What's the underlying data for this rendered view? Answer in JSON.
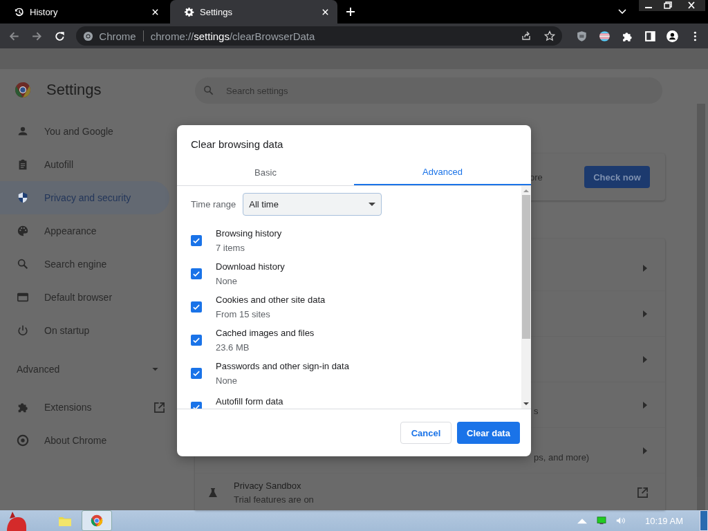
{
  "browser_tabs": [
    {
      "title": "History",
      "selected": false
    },
    {
      "title": "Settings",
      "selected": true
    }
  ],
  "address_bar": {
    "site_label": "Chrome",
    "url_scheme": "chrome://",
    "url_host": "settings",
    "url_path": "/clearBrowserData"
  },
  "settings": {
    "title": "Settings",
    "search": {
      "placeholder": "Search settings"
    },
    "sidebar": {
      "items": [
        {
          "label": "You and Google",
          "selected": false
        },
        {
          "label": "Autofill",
          "selected": false
        },
        {
          "label": "Privacy and security",
          "selected": true
        },
        {
          "label": "Appearance",
          "selected": false
        },
        {
          "label": "Search engine",
          "selected": false
        },
        {
          "label": "Default browser",
          "selected": false
        },
        {
          "label": "On startup",
          "selected": false
        }
      ],
      "advanced": {
        "label": "Advanced",
        "expanded": false
      },
      "links": [
        {
          "label": "Extensions",
          "external": true
        },
        {
          "label": "About Chrome",
          "external": false
        }
      ]
    },
    "safety_check": {
      "text_fragment": "ore",
      "button": "Check now"
    },
    "privacy_rows": [
      {},
      {},
      {},
      {
        "text": "s"
      },
      {
        "text": "ps, and more)"
      }
    ],
    "privacy_sandbox": {
      "title": "Privacy Sandbox",
      "subtitle": "Trial features are on"
    }
  },
  "dialog": {
    "title": "Clear browsing data",
    "tabs": [
      {
        "label": "Basic",
        "selected": false
      },
      {
        "label": "Advanced",
        "selected": true
      }
    ],
    "time_range": {
      "label": "Time range",
      "value": "All time"
    },
    "options": [
      {
        "label": "Browsing history",
        "detail": "7 items",
        "checked": true
      },
      {
        "label": "Download history",
        "detail": "None",
        "checked": true
      },
      {
        "label": "Cookies and other site data",
        "detail": "From 15 sites",
        "checked": true
      },
      {
        "label": "Cached images and files",
        "detail": "23.6 MB",
        "checked": true
      },
      {
        "label": "Passwords and other sign-in data",
        "detail": "None",
        "checked": true
      },
      {
        "label": "Autofill form data",
        "checked": true
      }
    ],
    "buttons": {
      "cancel": "Cancel",
      "confirm": "Clear data"
    }
  },
  "taskbar": {
    "clock": "10:19 AM"
  }
}
